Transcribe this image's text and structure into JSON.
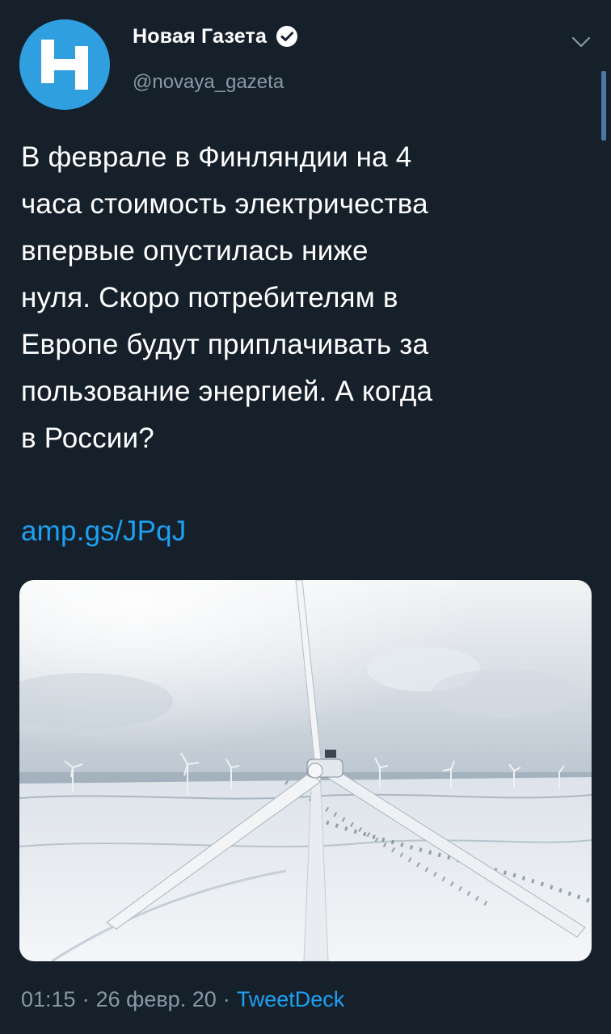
{
  "author": {
    "name": "Новая Газета",
    "handle": "@novaya_gazeta",
    "avatar_letter": "Н",
    "verified_icon": "verified-badge-icon"
  },
  "tweet": {
    "text": "В феврале в Финляндии на 4\nчаса стоимость электричества\nвпервые опустилась ниже\nнуля. Скоро потребителям в\nЕвропе будут приплачивать за\nпользование энергией. А когда\nв России?",
    "link": "amp.gs/JPqJ"
  },
  "media": {
    "description_icon": "wind-turbine-photo"
  },
  "meta": {
    "time": "01:15",
    "separator": "·",
    "date": "26 февр. 20",
    "separator2": "·",
    "source": "TweetDeck"
  },
  "colors": {
    "background": "#15202b",
    "accent": "#1da1f2",
    "secondary_text": "#8899a6",
    "avatar_bg": "#2f9fe0"
  }
}
